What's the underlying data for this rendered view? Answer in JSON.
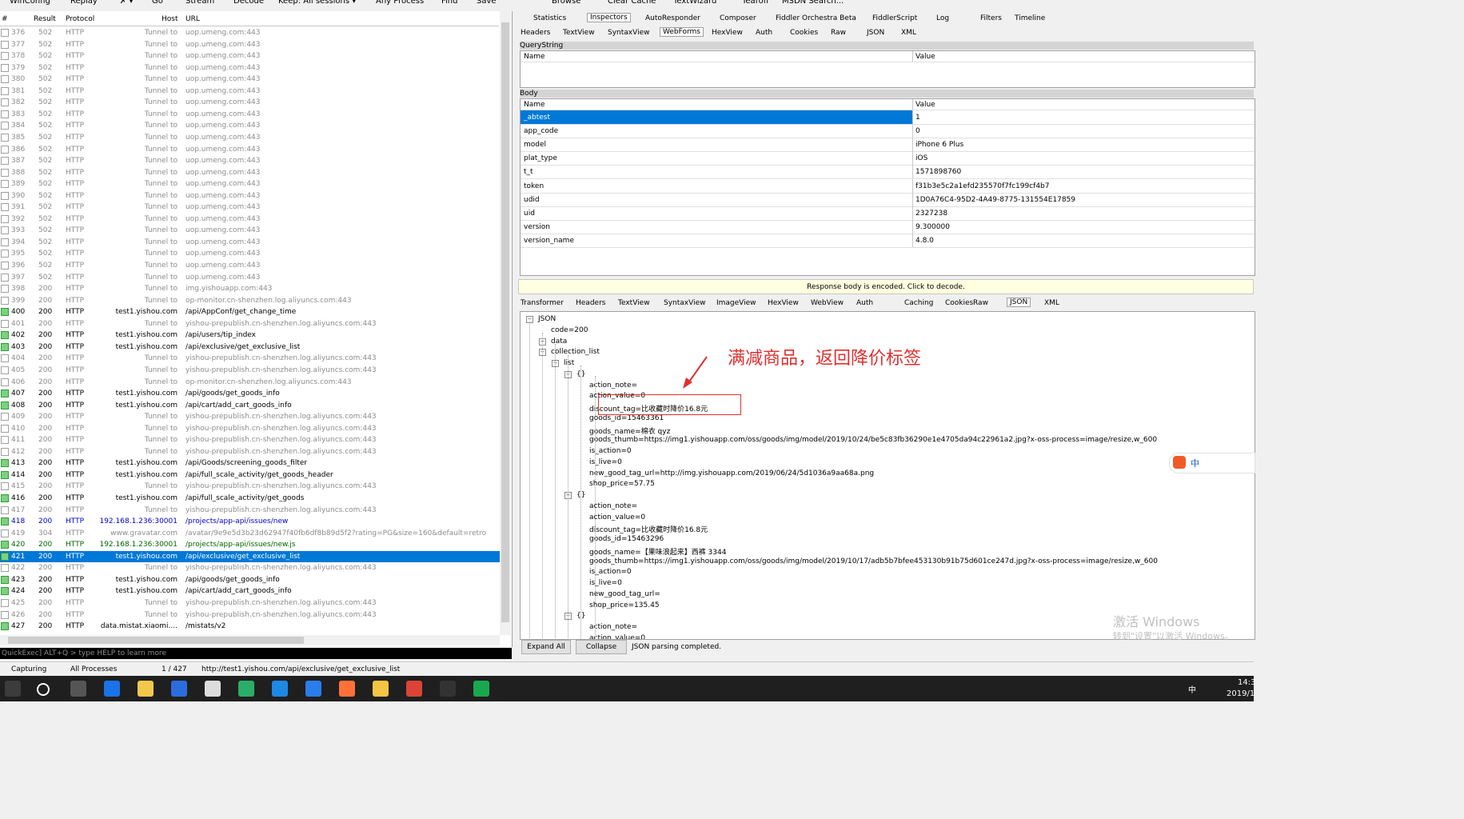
{
  "toolbar": {
    "items": [
      "WinConfig",
      "Replay",
      "✗ ▾",
      "Go",
      "Stream",
      "Decode",
      "Keep: All sessions ▾",
      "Any Process",
      "Find",
      "Save",
      "Browse",
      "Clear Cache",
      "TextWizard",
      "Tearoff",
      "MSDN Search..."
    ]
  },
  "sessions": {
    "columns": [
      "#",
      "Result",
      "Protocol",
      "Host",
      "URL"
    ],
    "rows": [
      {
        "id": "376",
        "result": "502",
        "protocol": "HTTP",
        "host": "Tunnel to",
        "url": "uop.umeng.com:443",
        "style": "gray"
      },
      {
        "id": "377",
        "result": "502",
        "protocol": "HTTP",
        "host": "Tunnel to",
        "url": "uop.umeng.com:443",
        "style": "gray"
      },
      {
        "id": "378",
        "result": "502",
        "protocol": "HTTP",
        "host": "Tunnel to",
        "url": "uop.umeng.com:443",
        "style": "gray"
      },
      {
        "id": "379",
        "result": "502",
        "protocol": "HTTP",
        "host": "Tunnel to",
        "url": "uop.umeng.com:443",
        "style": "gray"
      },
      {
        "id": "380",
        "result": "502",
        "protocol": "HTTP",
        "host": "Tunnel to",
        "url": "uop.umeng.com:443",
        "style": "gray"
      },
      {
        "id": "381",
        "result": "502",
        "protocol": "HTTP",
        "host": "Tunnel to",
        "url": "uop.umeng.com:443",
        "style": "gray"
      },
      {
        "id": "382",
        "result": "502",
        "protocol": "HTTP",
        "host": "Tunnel to",
        "url": "uop.umeng.com:443",
        "style": "gray"
      },
      {
        "id": "383",
        "result": "502",
        "protocol": "HTTP",
        "host": "Tunnel to",
        "url": "uop.umeng.com:443",
        "style": "gray"
      },
      {
        "id": "384",
        "result": "502",
        "protocol": "HTTP",
        "host": "Tunnel to",
        "url": "uop.umeng.com:443",
        "style": "gray"
      },
      {
        "id": "385",
        "result": "502",
        "protocol": "HTTP",
        "host": "Tunnel to",
        "url": "uop.umeng.com:443",
        "style": "gray"
      },
      {
        "id": "386",
        "result": "502",
        "protocol": "HTTP",
        "host": "Tunnel to",
        "url": "uop.umeng.com:443",
        "style": "gray"
      },
      {
        "id": "387",
        "result": "502",
        "protocol": "HTTP",
        "host": "Tunnel to",
        "url": "uop.umeng.com:443",
        "style": "gray"
      },
      {
        "id": "388",
        "result": "502",
        "protocol": "HTTP",
        "host": "Tunnel to",
        "url": "uop.umeng.com:443",
        "style": "gray"
      },
      {
        "id": "389",
        "result": "502",
        "protocol": "HTTP",
        "host": "Tunnel to",
        "url": "uop.umeng.com:443",
        "style": "gray"
      },
      {
        "id": "390",
        "result": "502",
        "protocol": "HTTP",
        "host": "Tunnel to",
        "url": "uop.umeng.com:443",
        "style": "gray"
      },
      {
        "id": "391",
        "result": "502",
        "protocol": "HTTP",
        "host": "Tunnel to",
        "url": "uop.umeng.com:443",
        "style": "gray"
      },
      {
        "id": "392",
        "result": "502",
        "protocol": "HTTP",
        "host": "Tunnel to",
        "url": "uop.umeng.com:443",
        "style": "gray"
      },
      {
        "id": "393",
        "result": "502",
        "protocol": "HTTP",
        "host": "Tunnel to",
        "url": "uop.umeng.com:443",
        "style": "gray"
      },
      {
        "id": "394",
        "result": "502",
        "protocol": "HTTP",
        "host": "Tunnel to",
        "url": "uop.umeng.com:443",
        "style": "gray"
      },
      {
        "id": "395",
        "result": "502",
        "protocol": "HTTP",
        "host": "Tunnel to",
        "url": "uop.umeng.com:443",
        "style": "gray"
      },
      {
        "id": "396",
        "result": "502",
        "protocol": "HTTP",
        "host": "Tunnel to",
        "url": "uop.umeng.com:443",
        "style": "gray"
      },
      {
        "id": "397",
        "result": "502",
        "protocol": "HTTP",
        "host": "Tunnel to",
        "url": "uop.umeng.com:443",
        "style": "gray"
      },
      {
        "id": "398",
        "result": "200",
        "protocol": "HTTP",
        "host": "Tunnel to",
        "url": "img.yishouapp.com:443",
        "style": "gray"
      },
      {
        "id": "399",
        "result": "200",
        "protocol": "HTTP",
        "host": "Tunnel to",
        "url": "op-monitor.cn-shenzhen.log.aliyuncs.com:443",
        "style": "gray"
      },
      {
        "id": "400",
        "result": "200",
        "protocol": "HTTP",
        "host": "test1.yishou.com",
        "url": "/api/AppConf/get_change_time",
        "style": "normal"
      },
      {
        "id": "401",
        "result": "200",
        "protocol": "HTTP",
        "host": "Tunnel to",
        "url": "yishou-prepublish.cn-shenzhen.log.aliyuncs.com:443",
        "style": "gray"
      },
      {
        "id": "402",
        "result": "200",
        "protocol": "HTTP",
        "host": "test1.yishou.com",
        "url": "/api/users/tip_index",
        "style": "normal"
      },
      {
        "id": "403",
        "result": "200",
        "protocol": "HTTP",
        "host": "test1.yishou.com",
        "url": "/api/exclusive/get_exclusive_list",
        "style": "normal"
      },
      {
        "id": "404",
        "result": "200",
        "protocol": "HTTP",
        "host": "Tunnel to",
        "url": "yishou-prepublish.cn-shenzhen.log.aliyuncs.com:443",
        "style": "gray"
      },
      {
        "id": "405",
        "result": "200",
        "protocol": "HTTP",
        "host": "Tunnel to",
        "url": "yishou-prepublish.cn-shenzhen.log.aliyuncs.com:443",
        "style": "gray"
      },
      {
        "id": "406",
        "result": "200",
        "protocol": "HTTP",
        "host": "Tunnel to",
        "url": "op-monitor.cn-shenzhen.log.aliyuncs.com:443",
        "style": "gray"
      },
      {
        "id": "407",
        "result": "200",
        "protocol": "HTTP",
        "host": "test1.yishou.com",
        "url": "/api/goods/get_goods_info",
        "style": "normal"
      },
      {
        "id": "408",
        "result": "200",
        "protocol": "HTTP",
        "host": "test1.yishou.com",
        "url": "/api/cart/add_cart_goods_info",
        "style": "normal"
      },
      {
        "id": "409",
        "result": "200",
        "protocol": "HTTP",
        "host": "Tunnel to",
        "url": "yishou-prepublish.cn-shenzhen.log.aliyuncs.com:443",
        "style": "gray"
      },
      {
        "id": "410",
        "result": "200",
        "protocol": "HTTP",
        "host": "Tunnel to",
        "url": "yishou-prepublish.cn-shenzhen.log.aliyuncs.com:443",
        "style": "gray"
      },
      {
        "id": "411",
        "result": "200",
        "protocol": "HTTP",
        "host": "Tunnel to",
        "url": "yishou-prepublish.cn-shenzhen.log.aliyuncs.com:443",
        "style": "gray"
      },
      {
        "id": "412",
        "result": "200",
        "protocol": "HTTP",
        "host": "Tunnel to",
        "url": "yishou-prepublish.cn-shenzhen.log.aliyuncs.com:443",
        "style": "gray"
      },
      {
        "id": "413",
        "result": "200",
        "protocol": "HTTP",
        "host": "test1.yishou.com",
        "url": "/api/Goods/screening_goods_filter",
        "style": "normal"
      },
      {
        "id": "414",
        "result": "200",
        "protocol": "HTTP",
        "host": "test1.yishou.com",
        "url": "/api/full_scale_activity/get_goods_header",
        "style": "normal"
      },
      {
        "id": "415",
        "result": "200",
        "protocol": "HTTP",
        "host": "Tunnel to",
        "url": "yishou-prepublish.cn-shenzhen.log.aliyuncs.com:443",
        "style": "gray"
      },
      {
        "id": "416",
        "result": "200",
        "protocol": "HTTP",
        "host": "test1.yishou.com",
        "url": "/api/full_scale_activity/get_goods",
        "style": "normal"
      },
      {
        "id": "417",
        "result": "200",
        "protocol": "HTTP",
        "host": "Tunnel to",
        "url": "yishou-prepublish.cn-shenzhen.log.aliyuncs.com:443",
        "style": "gray"
      },
      {
        "id": "418",
        "result": "200",
        "protocol": "HTTP",
        "host": "192.168.1.236:30001",
        "url": "/projects/app-api/issues/new",
        "style": "blue"
      },
      {
        "id": "419",
        "result": "304",
        "protocol": "HTTP",
        "host": "www.gravatar.com",
        "url": "/avatar/9e9e5d3b23d62947f40fb6df8b89d5f2?rating=PG&size=160&default=retro",
        "style": "gray"
      },
      {
        "id": "420",
        "result": "200",
        "protocol": "HTTP",
        "host": "192.168.1.236:30001",
        "url": "/projects/app-api/issues/new.js",
        "style": "green"
      },
      {
        "id": "421",
        "result": "200",
        "protocol": "HTTP",
        "host": "test1.yishou.com",
        "url": "/api/exclusive/get_exclusive_list",
        "style": "sel"
      },
      {
        "id": "422",
        "result": "200",
        "protocol": "HTTP",
        "host": "Tunnel to",
        "url": "yishou-prepublish.cn-shenzhen.log.aliyuncs.com:443",
        "style": "gray"
      },
      {
        "id": "423",
        "result": "200",
        "protocol": "HTTP",
        "host": "test1.yishou.com",
        "url": "/api/goods/get_goods_info",
        "style": "normal"
      },
      {
        "id": "424",
        "result": "200",
        "protocol": "HTTP",
        "host": "test1.yishou.com",
        "url": "/api/cart/add_cart_goods_info",
        "style": "normal"
      },
      {
        "id": "425",
        "result": "200",
        "protocol": "HTTP",
        "host": "Tunnel to",
        "url": "yishou-prepublish.cn-shenzhen.log.aliyuncs.com:443",
        "style": "gray"
      },
      {
        "id": "426",
        "result": "200",
        "protocol": "HTTP",
        "host": "Tunnel to",
        "url": "yishou-prepublish.cn-shenzhen.log.aliyuncs.com:443",
        "style": "gray"
      },
      {
        "id": "427",
        "result": "200",
        "protocol": "HTTP",
        "host": "data.mistat.xiaomi....",
        "url": "/mistats/v2",
        "style": "normal"
      }
    ]
  },
  "quickexec": "QuickExec] ALT+Q > type HELP to learn more",
  "inspector_tabs": [
    "Statistics",
    "Inspectors",
    "AutoResponder",
    "Composer",
    "Fiddler Orchestra Beta",
    "FiddlerScript",
    "Log",
    "Filters",
    "Timeline"
  ],
  "request_tabs": [
    "Headers",
    "TextView",
    "SyntaxView",
    "WebForms",
    "HexView",
    "Auth",
    "Cookies",
    "Raw",
    "JSON",
    "XML"
  ],
  "querystring": {
    "label": "QueryString",
    "name_col": "Name",
    "value_col": "Value"
  },
  "body": {
    "label": "Body",
    "name_col": "Name",
    "value_col": "Value",
    "rows": [
      {
        "name": "_abtest",
        "value": "1"
      },
      {
        "name": "app_code",
        "value": "0"
      },
      {
        "name": "model",
        "value": "iPhone 6 Plus"
      },
      {
        "name": "plat_type",
        "value": "iOS"
      },
      {
        "name": "t_t",
        "value": "1571898760"
      },
      {
        "name": "token",
        "value": "f31b3e5c2a1efd235570f7fc199cf4b7"
      },
      {
        "name": "udid",
        "value": "1D0A76C4-95D2-4A49-8775-131554E17859"
      },
      {
        "name": "uid",
        "value": "2327238"
      },
      {
        "name": "version",
        "value": "9.300000"
      },
      {
        "name": "version_name",
        "value": "4.8.0"
      }
    ]
  },
  "encoded_notice": "Response body is encoded. Click to decode.",
  "response_tabs": [
    "Transformer",
    "Headers",
    "TextView",
    "SyntaxView",
    "ImageView",
    "HexView",
    "WebView",
    "Auth",
    "Caching",
    "Cookies",
    "Raw",
    "JSON",
    "XML"
  ],
  "json_tree": [
    {
      "indent": 0,
      "text": "JSON",
      "box": "-"
    },
    {
      "indent": 1,
      "text": "code=200"
    },
    {
      "indent": 1,
      "text": "data",
      "box": "-"
    },
    {
      "indent": 2,
      "text": "collection_list",
      "box": "-"
    },
    {
      "indent": 3,
      "text": "list",
      "box": "-"
    },
    {
      "indent": 4,
      "text": "{}",
      "box": "-"
    },
    {
      "indent": 5,
      "text": "action_note="
    },
    {
      "indent": 5,
      "text": "action_value=0"
    },
    {
      "indent": 5,
      "text": "discount_tag=比收藏时降价16.8元"
    },
    {
      "indent": 5,
      "text": "goods_id=15463361"
    },
    {
      "indent": 5,
      "text": "goods_name=棉衣 qyz"
    },
    {
      "indent": 5,
      "text": "goods_thumb=https://img1.yishouapp.com/oss/goods/img/model/2019/10/24/be5c83fb36290e1e4705da94c22961a2.jpg?x-oss-process=image/resize,w_600"
    },
    {
      "indent": 5,
      "text": "is_action=0"
    },
    {
      "indent": 5,
      "text": "is_live=0"
    },
    {
      "indent": 5,
      "text": "new_good_tag_url=http://img.yishouapp.com/2019/06/24/5d1036a9aa68a.png"
    },
    {
      "indent": 5,
      "text": "shop_price=57.75"
    },
    {
      "indent": 4,
      "text": "{}",
      "box": "-"
    },
    {
      "indent": 5,
      "text": "action_note="
    },
    {
      "indent": 5,
      "text": "action_value=0"
    },
    {
      "indent": 5,
      "text": "discount_tag=比收藏时降价16.8元"
    },
    {
      "indent": 5,
      "text": "goods_id=15463296"
    },
    {
      "indent": 5,
      "text": "goods_name=【果味浪起来】西裤 3344"
    },
    {
      "indent": 5,
      "text": "goods_thumb=https://img1.yishouapp.com/oss/goods/img/model/2019/10/17/adb5b7bfee453130b91b75d601ce247d.jpg?x-oss-process=image/resize,w_600"
    },
    {
      "indent": 5,
      "text": "is_action=0"
    },
    {
      "indent": 5,
      "text": "is_live=0"
    },
    {
      "indent": 5,
      "text": "new_good_tag_url="
    },
    {
      "indent": 5,
      "text": "shop_price=135.45"
    },
    {
      "indent": 4,
      "text": "{}",
      "box": "-"
    },
    {
      "indent": 5,
      "text": "action_note="
    },
    {
      "indent": 5,
      "text": "action_value=0"
    }
  ],
  "annotation": "满减商品，返回降价标签",
  "buttons": {
    "expand_all": "Expand All",
    "collapse": "Collapse",
    "parse_status": "JSON parsing completed."
  },
  "statusbar": {
    "capturing": "Capturing",
    "processes": "All Processes",
    "count": "1 / 427",
    "url": "http://test1.yishou.com/api/exclusive/get_exclusive_list"
  },
  "watermark": {
    "line1": "激活 Windows",
    "line2": "转到\"设置\"以激活 Windows。"
  },
  "tray": {
    "ime": "中",
    "time": "14:3",
    "date": "2019/1"
  },
  "colors": {
    "selection": "#0078d7",
    "annotation": "#e03030"
  }
}
